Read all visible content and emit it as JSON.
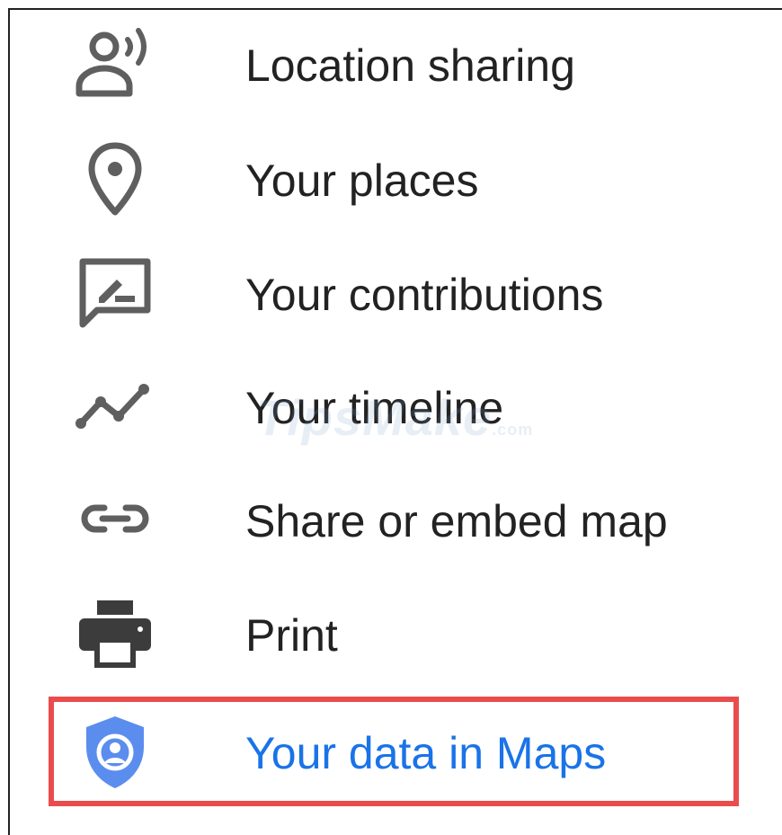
{
  "menu": {
    "items": [
      {
        "label": "Location sharing",
        "icon": "location-sharing-icon"
      },
      {
        "label": "Your places",
        "icon": "place-pin-icon"
      },
      {
        "label": "Your contributions",
        "icon": "contributions-icon"
      },
      {
        "label": "Your timeline",
        "icon": "timeline-icon"
      },
      {
        "label": "Share or embed map",
        "icon": "link-icon"
      },
      {
        "label": "Print",
        "icon": "print-icon"
      },
      {
        "label": "Your data in Maps",
        "icon": "shield-person-icon"
      }
    ]
  },
  "watermark": {
    "text": "TipsMake",
    "suffix": ".com"
  },
  "colors": {
    "icon": "#5f5f5f",
    "text": "#222222",
    "active_text": "#1a73e8",
    "active_icon": "#5b8def",
    "highlight_border": "#ea4c4c"
  }
}
